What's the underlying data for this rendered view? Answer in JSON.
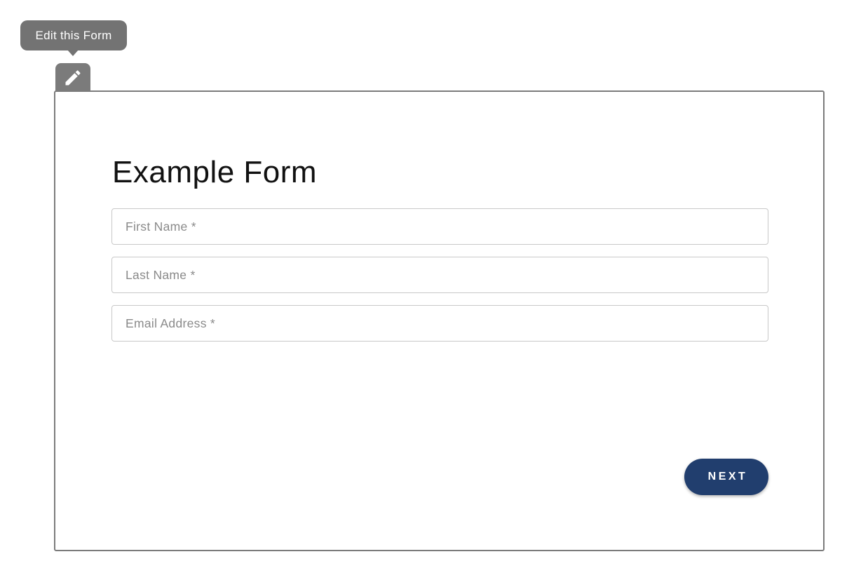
{
  "tooltip": {
    "label": "Edit this Form"
  },
  "edit_tab": {
    "icon": "pencil-icon"
  },
  "form": {
    "title": "Example Form",
    "fields": [
      {
        "placeholder": "First Name *",
        "value": ""
      },
      {
        "placeholder": "Last Name *",
        "value": ""
      },
      {
        "placeholder": "Email Address *",
        "value": ""
      }
    ],
    "next_label": "NEXT"
  },
  "colors": {
    "tooltip_bg": "#737373",
    "frame_border": "#7b7b7b",
    "button_bg": "#213e6e",
    "button_text": "#ffffff"
  }
}
